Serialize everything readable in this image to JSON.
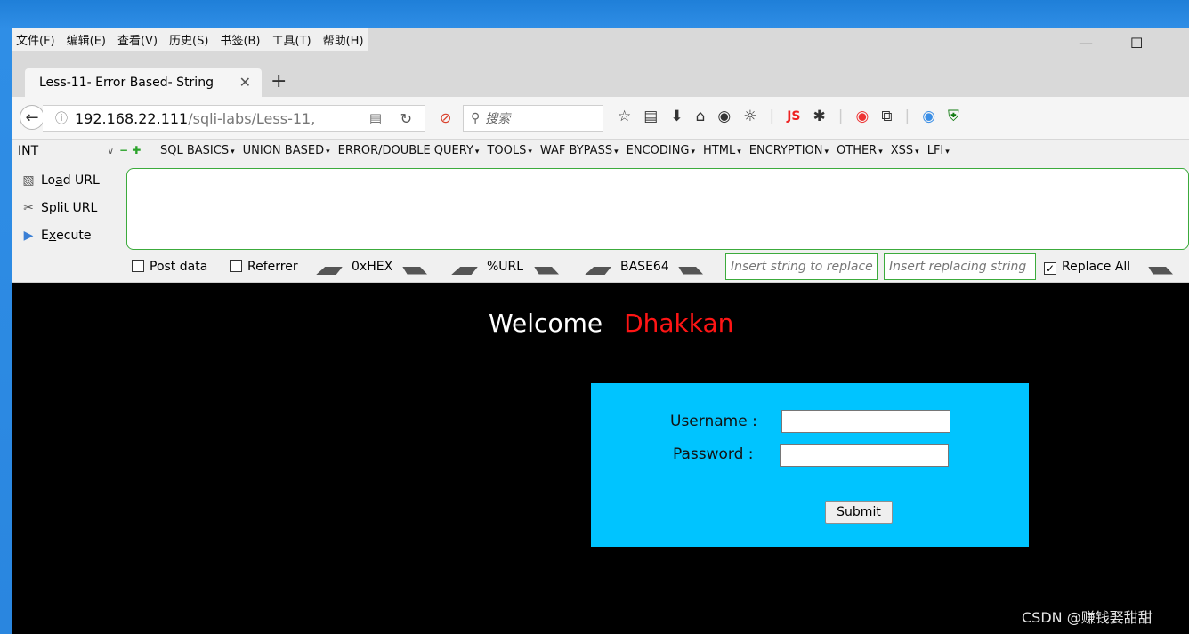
{
  "menu": [
    "文件(F)",
    "编辑(E)",
    "查看(V)",
    "历史(S)",
    "书签(B)",
    "工具(T)",
    "帮助(H)"
  ],
  "window_controls": {
    "minimize": "—",
    "maximize": "☐"
  },
  "tab": {
    "title": "Less-11- Error Based- String",
    "close": "✕",
    "new_tab": "+"
  },
  "nav": {
    "url_host": "192.168.22.111",
    "url_path": "/sqli-labs/Less-11,",
    "search_placeholder": "搜索"
  },
  "hackbar": {
    "selector": "INT",
    "menus": [
      "SQL BASICS",
      "UNION BASED",
      "ERROR/DOUBLE QUERY",
      "TOOLS",
      "WAF BYPASS",
      "ENCODING",
      "HTML",
      "ENCRYPTION",
      "OTHER",
      "XSS",
      "LFI"
    ],
    "load_url": {
      "pre": "Lo",
      "key": "a",
      "post": "d URL"
    },
    "split_url": {
      "pre": "",
      "key": "S",
      "post": "plit URL"
    },
    "execute": {
      "pre": "E",
      "key": "x",
      "post": "ecute"
    },
    "post_data": "Post data",
    "referrer": "Referrer",
    "hex": "0xHEX",
    "url": "%URL",
    "base64": "BASE64",
    "replace_placeholder": "Insert string to replace",
    "replacing_placeholder": "Insert replacing string",
    "replace_all": "Replace All",
    "replace_all_checked": true
  },
  "page": {
    "welcome": "Welcome",
    "name": "Dhakkan",
    "username_label": "Username :",
    "password_label": "Password :",
    "submit": "Submit"
  },
  "watermark": "CSDN @赚钱娶甜甜",
  "colors": {
    "login_box": "#00c4ff",
    "name": "#ff1515",
    "hackbar_border": "#3cab3c"
  }
}
